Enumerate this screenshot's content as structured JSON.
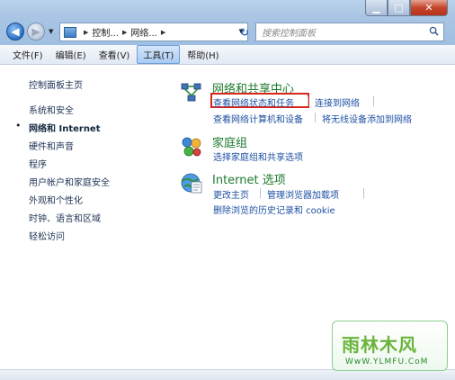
{
  "window": {
    "min_symbol": "▁",
    "max_symbol": "□",
    "close_symbol": "✕"
  },
  "nav": {
    "back_symbol": "◀",
    "forward_symbol": "▶",
    "dropdown_symbol": "▼"
  },
  "address": {
    "crumbs": [
      "控制...",
      "网络..."
    ],
    "sep": "▶",
    "dropdown_symbol": "▼",
    "refresh_symbol": "↻"
  },
  "search": {
    "placeholder": "搜索控制面板"
  },
  "menu": {
    "items": [
      "文件(F)",
      "编辑(E)",
      "查看(V)",
      "工具(T)",
      "帮助(H)"
    ],
    "active_index": 3
  },
  "sidebar": {
    "items": [
      "控制面板主页",
      "系统和安全",
      "网络和 Internet",
      "硬件和声音",
      "程序",
      "用户帐户和家庭安全",
      "外观和个性化",
      "时钟、语言和区域",
      "轻松访问"
    ],
    "current_index": 2,
    "bullet": "•"
  },
  "main": {
    "network": {
      "title": "网络和共享中心",
      "links": [
        "查看网络状态和任务",
        "连接到网络",
        "查看网络计算机和设备",
        "将无线设备添加到网络"
      ]
    },
    "homegroup": {
      "title": "家庭组",
      "links": [
        "选择家庭组和共享选项"
      ]
    },
    "internet_options": {
      "title": "Internet 选项",
      "links": [
        "更改主页",
        "管理浏览器加载项",
        "删除浏览的历史记录和 cookie"
      ]
    }
  },
  "watermark": {
    "text": "雨林木风",
    "url": "WwW.YLMFU.CoM"
  },
  "colors": {
    "link": "#1e50a2",
    "category_title": "#1e7a2e",
    "highlight": "#d9261c"
  }
}
